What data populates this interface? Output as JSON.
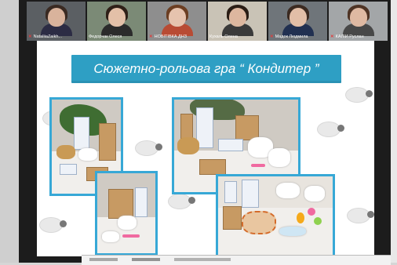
{
  "participants": [
    {
      "name": "NataliiaZaikh...",
      "muted": true,
      "hair": "#3a2a22",
      "skin": "#d9b39c",
      "shirt": "#2c2c44",
      "bg": "#5b5f63"
    },
    {
      "name": "Федорчак Олеся",
      "muted": false,
      "hair": "#2f2018",
      "skin": "#e3c0a8",
      "shirt": "#2b2b2b",
      "bg": "#7b8a76"
    },
    {
      "name": "НОВІТІВКА ДНЗ",
      "muted": true,
      "hair": "#6b3e22",
      "skin": "#e6c3ae",
      "shirt": "#b84b34",
      "bg": "#8e8e8e"
    },
    {
      "name": "Кухаль Олена",
      "muted": false,
      "hair": "#2a1d15",
      "skin": "#ddb79f",
      "shirt": "#3a3a3a",
      "bg": "#c9c3b6"
    },
    {
      "name": "Мадок Людмила",
      "muted": true,
      "hair": "#3b2a21",
      "skin": "#e2bea7",
      "shirt": "#213051",
      "bg": "#6f757a"
    },
    {
      "name": "КАЛІЙ Руслан",
      "muted": true,
      "hair": "#4e3324",
      "skin": "#dfb9a2",
      "shirt": "#484848",
      "bg": "#a3a6a8"
    }
  ],
  "slide": {
    "title": "Сюжетно-рольова гра “ Кондитер ”",
    "accent": "#2e9fc4",
    "photo_border": "#37a8d6"
  }
}
